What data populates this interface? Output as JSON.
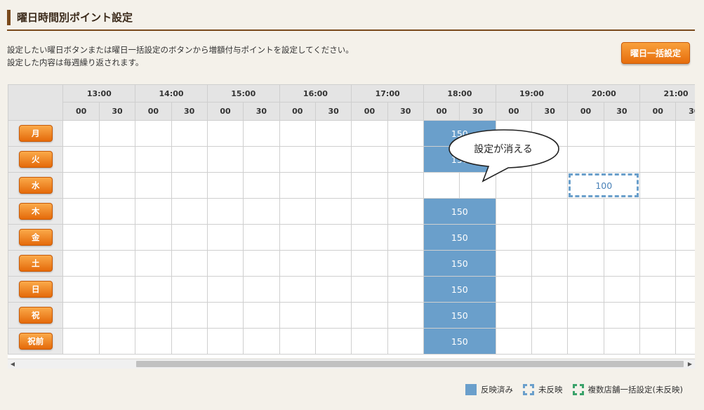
{
  "header": {
    "title": "曜日時間別ポイント設定"
  },
  "description": {
    "line1": "設定したい曜日ボタンまたは曜日一括設定のボタンから増額付与ポイントを設定してください。",
    "line2": "設定した内容は毎週繰り返されます。"
  },
  "bulk_button": {
    "label": "曜日一括設定"
  },
  "grid": {
    "hours": [
      "13:00",
      "14:00",
      "15:00",
      "16:00",
      "17:00",
      "18:00",
      "19:00",
      "20:00",
      "21:00"
    ],
    "minutes": [
      "00",
      "30"
    ],
    "days": [
      "月",
      "火",
      "水",
      "木",
      "金",
      "土",
      "日",
      "祝",
      "祝前"
    ],
    "applied_value": "150",
    "applied_slot_index": 5,
    "pending": {
      "day": "水",
      "hour": "20:00",
      "value": "100"
    }
  },
  "callout": {
    "text": "設定が消える"
  },
  "scrollbar": {
    "left_icon": "◀",
    "right_icon": "▶"
  },
  "legend": {
    "applied": "反映済み",
    "pending": "未反映",
    "multi_store": "複数店舗一括設定(未反映)"
  },
  "colors": {
    "applied": "#6a9fcb",
    "pending_border": "#6a9fcb",
    "multi_store_border": "#3aa26a",
    "button_orange": "#e66d0c",
    "header_brown": "#7a4a1c"
  }
}
